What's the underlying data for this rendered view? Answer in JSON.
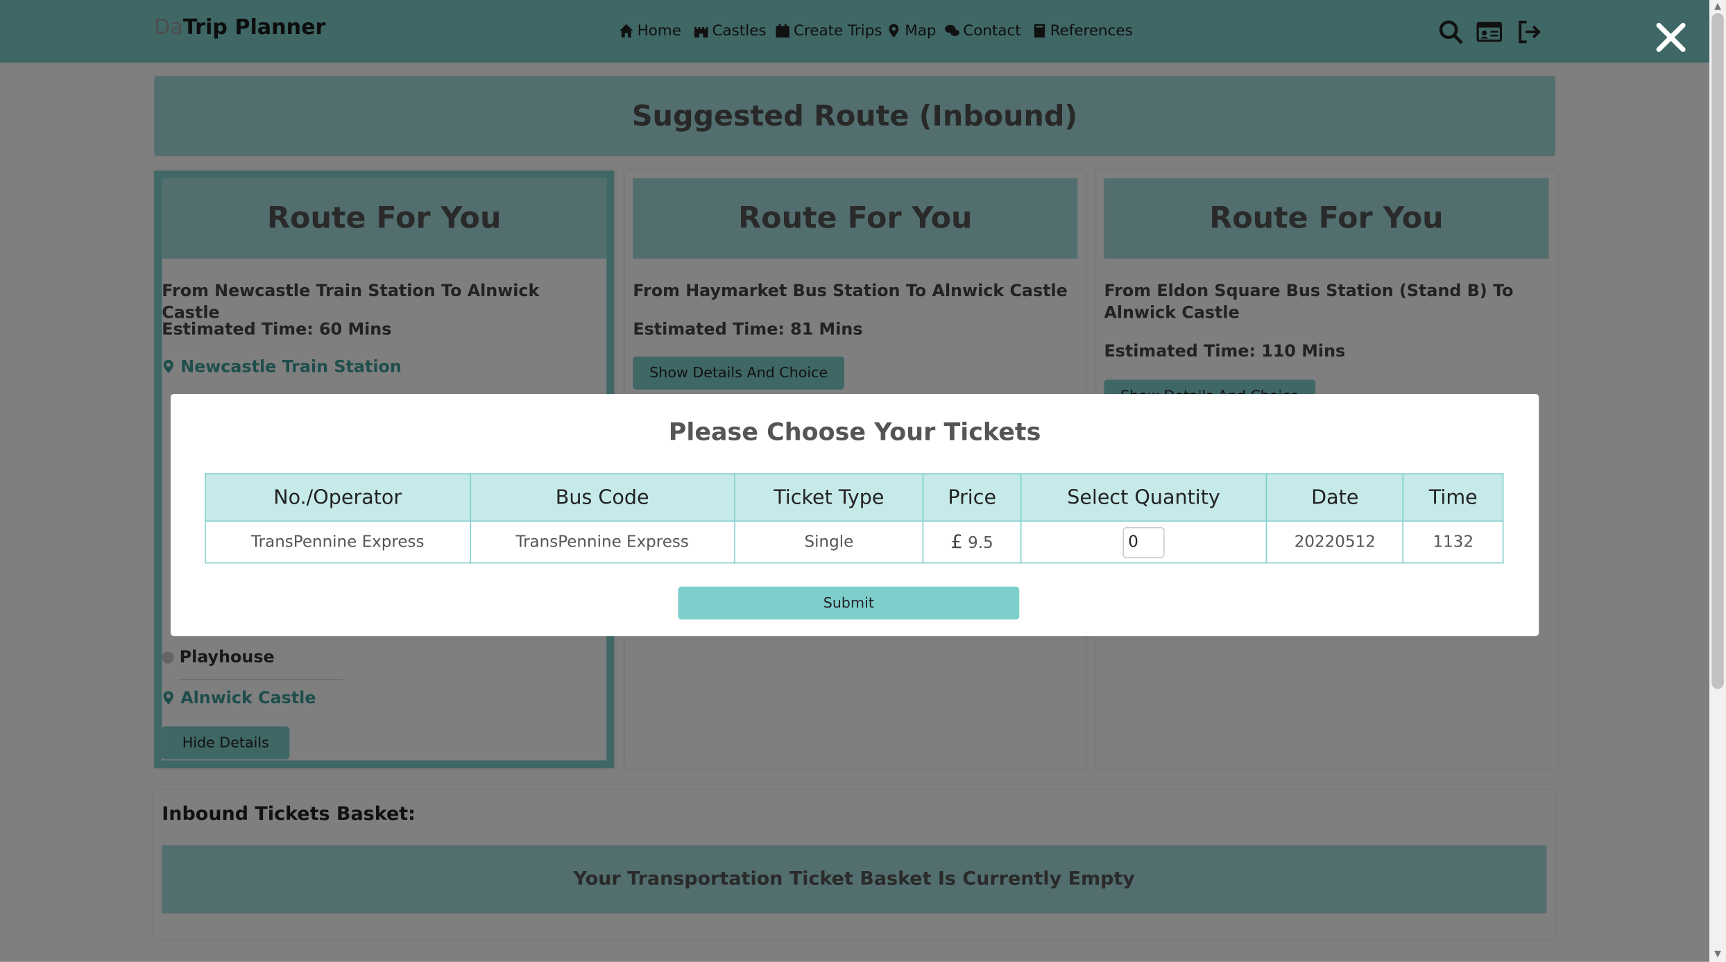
{
  "navbar": {
    "brand_prefix": "Da",
    "brand": "Trip Planner",
    "links": [
      {
        "label": "Home",
        "icon": "home-icon"
      },
      {
        "label": "Castles",
        "icon": "castle-icon"
      },
      {
        "label": "Create Trips",
        "icon": "calendar-icon"
      },
      {
        "label": "Map",
        "icon": "map-pin-icon"
      },
      {
        "label": "Contact",
        "icon": "chat-icon"
      },
      {
        "label": "References",
        "icon": "book-icon"
      }
    ],
    "right_icons": [
      "search-icon",
      "id-card-icon",
      "logout-icon"
    ]
  },
  "page": {
    "suggested_title": "Suggested Route (Inbound)",
    "routes": [
      {
        "heading": "Route For You",
        "from_to": "From Newcastle Train Station To Alnwick Castle",
        "estimated": "Estimated Time: 60 Mins",
        "start_stop": "Newcastle Train Station",
        "mid_stop": "Playhouse",
        "end_stop": "Alnwick Castle",
        "button": "Hide Details",
        "selected": true
      },
      {
        "heading": "Route For You",
        "from_to": "From Haymarket Bus Station To Alnwick Castle",
        "estimated": "Estimated Time: 81 Mins",
        "button": "Show Details And Choice"
      },
      {
        "heading": "Route For You",
        "from_to": "From Eldon Square Bus Station (Stand B) To Alnwick Castle",
        "estimated": "Estimated Time: 110 Mins",
        "button": "Show Details And Choice"
      }
    ],
    "basket_title": "Inbound Tickets Basket:",
    "basket_empty": "Your Transportation Ticket Basket Is Currently Empty"
  },
  "modal": {
    "title": "Please Choose Your Tickets",
    "columns": [
      "No./Operator",
      "Bus Code",
      "Ticket Type",
      "Price",
      "Select Quantity",
      "Date",
      "Time"
    ],
    "row": {
      "operator": "TransPennine Express",
      "bus_code": "TransPennine Express",
      "ticket_type": "Single",
      "price_symbol": "£",
      "price": "9.5",
      "quantity": "0",
      "date": "20220512",
      "time": "1132"
    },
    "submit": "Submit",
    "close_icon": "close-icon"
  },
  "colors": {
    "accent": "#7ecfcb",
    "header_bg": "#a7dcdc",
    "table_header": "#c6e9e9"
  }
}
